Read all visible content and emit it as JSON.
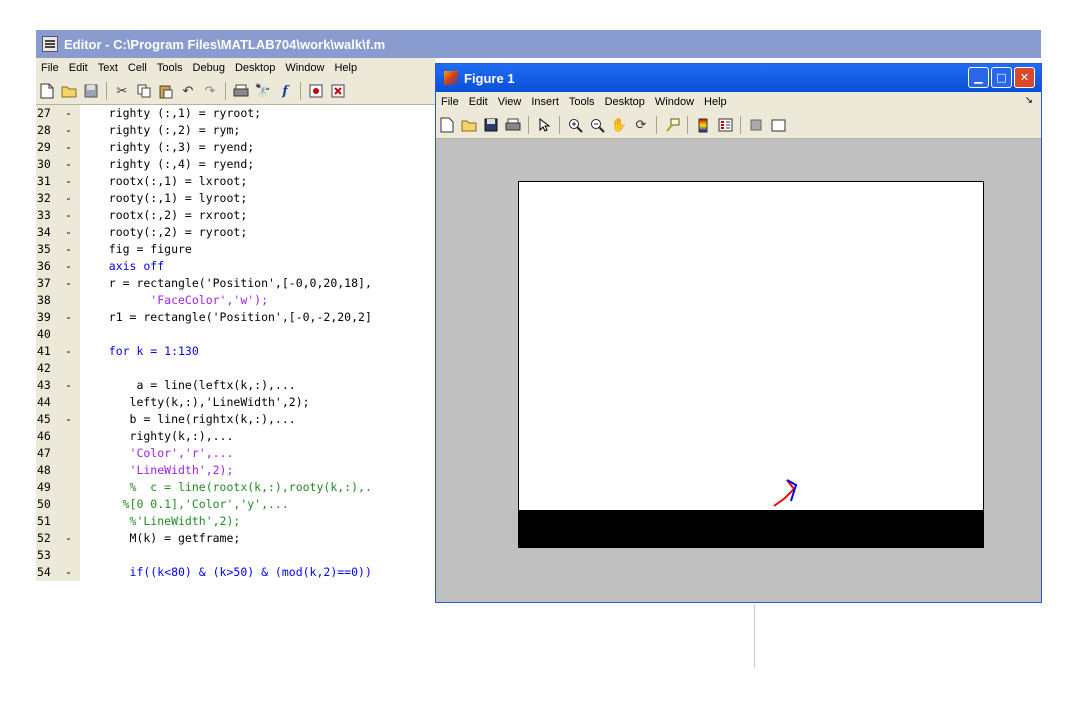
{
  "editor": {
    "title": "Editor - C:\\Program Files\\MATLAB704\\work\\walk\\f.m",
    "menu": [
      "File",
      "Edit",
      "Text",
      "Cell",
      "Tools",
      "Debug",
      "Desktop",
      "Window",
      "Help"
    ],
    "toolbar_icons": [
      "new-file-icon",
      "open-folder-icon",
      "save-icon",
      "cut-icon",
      "copy-icon",
      "paste-icon",
      "undo-icon",
      "redo-icon",
      "print-icon",
      "find-icon",
      "function-icon",
      "breakpoint-set-icon",
      "breakpoint-clear-icon"
    ],
    "lines": [
      {
        "n": "27",
        "dash": "-",
        "text": "   righty (:,1) = ryroot;"
      },
      {
        "n": "28",
        "dash": "-",
        "text": "   righty (:,2) = rym;"
      },
      {
        "n": "29",
        "dash": "-",
        "text": "   righty (:,3) = ryend;"
      },
      {
        "n": "30",
        "dash": "-",
        "text": "   righty (:,4) = ryend;"
      },
      {
        "n": "31",
        "dash": "-",
        "text": "   rootx(:,1) = lxroot;"
      },
      {
        "n": "32",
        "dash": "-",
        "text": "   rooty(:,1) = lyroot;"
      },
      {
        "n": "33",
        "dash": "-",
        "text": "   rootx(:,2) = rxroot;"
      },
      {
        "n": "34",
        "dash": "-",
        "text": "   rooty(:,2) = ryroot;"
      },
      {
        "n": "35",
        "dash": "-",
        "text": "   fig = figure"
      },
      {
        "n": "36",
        "dash": "-",
        "text": "   axis off"
      },
      {
        "n": "37",
        "dash": "-",
        "text": "   r = rectangle('Position',[-0,0,20,18],"
      },
      {
        "n": "38",
        "dash": "",
        "text": "         'FaceColor','w');"
      },
      {
        "n": "39",
        "dash": "-",
        "text": "   r1 = rectangle('Position',[-0,-2,20,2]"
      },
      {
        "n": "40",
        "dash": "",
        "text": ""
      },
      {
        "n": "41",
        "dash": "-",
        "text": "   for k = 1:130"
      },
      {
        "n": "42",
        "dash": "",
        "text": ""
      },
      {
        "n": "43",
        "dash": "-",
        "text": "       a = line(leftx(k,:),..."
      },
      {
        "n": "44",
        "dash": "",
        "text": "      lefty(k,:),'LineWidth',2);"
      },
      {
        "n": "45",
        "dash": "-",
        "text": "      b = line(rightx(k,:),..."
      },
      {
        "n": "46",
        "dash": "",
        "text": "      righty(k,:),..."
      },
      {
        "n": "47",
        "dash": "",
        "text": "      'Color','r',..."
      },
      {
        "n": "48",
        "dash": "",
        "text": "      'LineWidth',2);"
      },
      {
        "n": "49",
        "dash": "",
        "text": "      %  c = line(rootx(k,:),rooty(k,:),."
      },
      {
        "n": "50",
        "dash": "",
        "text": "     %[0 0.1],'Color','y',..."
      },
      {
        "n": "51",
        "dash": "",
        "text": "      %'LineWidth',2);"
      },
      {
        "n": "52",
        "dash": "-",
        "text": "      M(k) = getframe;"
      },
      {
        "n": "53",
        "dash": "",
        "text": ""
      },
      {
        "n": "54",
        "dash": "-",
        "text": "      if((k<80) & (k>50) & (mod(k,2)==0))"
      }
    ]
  },
  "figure": {
    "title": "Figure 1",
    "menu": [
      "File",
      "Edit",
      "View",
      "Insert",
      "Tools",
      "Desktop",
      "Window",
      "Help"
    ],
    "toolbar_icons": [
      "new-figure-icon",
      "open-icon",
      "save-icon",
      "print-icon",
      "edit-plot-arrow-icon",
      "zoom-in-icon",
      "zoom-out-icon",
      "pan-hand-icon",
      "rotate-3d-icon",
      "data-cursor-icon",
      "colorbar-icon",
      "legend-icon",
      "hide-plot-tools-icon",
      "show-plot-tools-icon"
    ],
    "colors": {
      "left_leg": "#0000ff",
      "right_leg": "#ff0000",
      "ground": "#000000",
      "background": "#c0c0c0"
    }
  }
}
